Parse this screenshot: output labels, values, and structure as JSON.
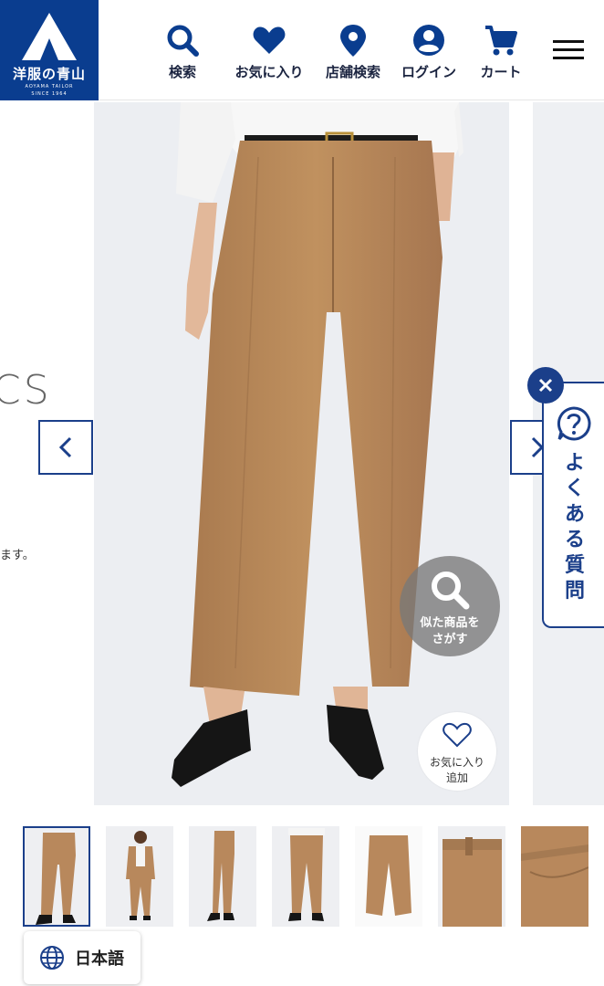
{
  "header": {
    "logo": {
      "brand": "洋服の青山",
      "tagline": "AOYAMA TAILOR",
      "since": "SINCE 1964",
      "color": "#0a3d8f"
    },
    "nav": [
      {
        "label": "検索",
        "icon": "search-icon"
      },
      {
        "label": "お気に入り",
        "icon": "heart-icon"
      },
      {
        "label": "店舗検索",
        "icon": "map-pin-icon"
      },
      {
        "label": "ログイン",
        "icon": "user-icon"
      },
      {
        "label": "カート",
        "icon": "cart-icon"
      }
    ],
    "menu_icon": "hamburger-menu-icon"
  },
  "carousel": {
    "left_partial_text": "CS",
    "left_partial_note": "ます。",
    "prev_icon": "chevron-left-icon",
    "next_icon": "chevron-right-icon",
    "similar_button": {
      "line1": "似た商品を",
      "line2": "さがす",
      "icon": "search-icon"
    },
    "favorite_button": {
      "line1": "お気に入り",
      "line2": "追加",
      "icon": "heart-outline-icon"
    }
  },
  "faq": {
    "label": "よくある質問",
    "icon": "question-circle-icon",
    "close_icon": "close-icon"
  },
  "thumbnails": [
    {
      "kind": "pants-front-model",
      "active": true
    },
    {
      "kind": "full-suit-model",
      "active": false
    },
    {
      "kind": "pants-side-model",
      "active": false
    },
    {
      "kind": "pants-back-model",
      "active": false
    },
    {
      "kind": "pants-flat",
      "active": false
    },
    {
      "kind": "pants-detail-waist",
      "active": false
    },
    {
      "kind": "pants-detail-fabric",
      "active": false
    }
  ],
  "language": {
    "label": "日本語",
    "icon": "globe-icon"
  },
  "colors": {
    "accent": "#1b3f8a",
    "fabric": "#b8885c",
    "shoe": "#1a1a1a"
  }
}
